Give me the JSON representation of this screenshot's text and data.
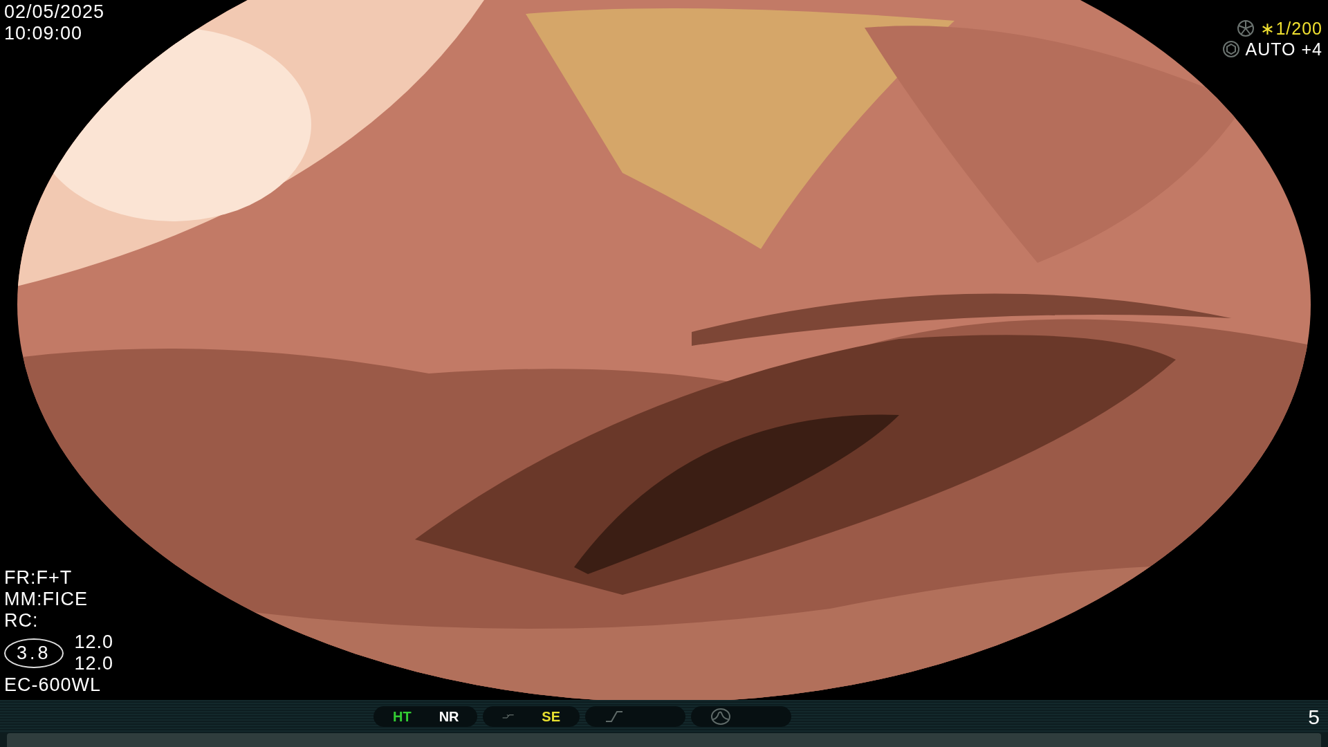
{
  "datetime": {
    "date": "02/05/2025",
    "time": "10:09:00"
  },
  "exposure": {
    "shutter": "∗1/200",
    "iris": "AUTO +4"
  },
  "settings": [
    {
      "text": "FR:F+T"
    },
    {
      "text": "MM:FICE"
    },
    {
      "text": "RC:"
    }
  ],
  "gauge": {
    "value": "3.8",
    "readings": [
      "12.0",
      "12.0"
    ]
  },
  "scope_model": "EC-600WL",
  "status_bar": {
    "groups": [
      {
        "kind": "labels",
        "items": [
          {
            "text": "HT",
            "color": "#33cc33"
          },
          {
            "text": "NR",
            "color": "#ffffff"
          }
        ]
      },
      {
        "kind": "curve",
        "items": [
          {
            "text": "SE",
            "color": "#e8e030"
          }
        ]
      },
      {
        "kind": "slope"
      },
      {
        "kind": "peak"
      }
    ],
    "page": "5"
  }
}
